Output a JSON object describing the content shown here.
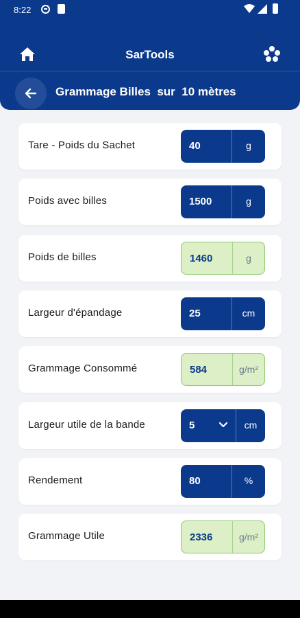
{
  "status_bar": {
    "time": "8:22"
  },
  "header": {
    "app_title": "SarTools",
    "screen_title": "Grammage Billes  sur  10 mètres",
    "icons": {
      "home": "home-icon",
      "settings": "flower-settings-icon",
      "back": "arrow-left-icon"
    }
  },
  "colors": {
    "primary": "#0b3a8c",
    "computed_bg": "#dcefc6",
    "computed_border": "#8cc96f",
    "page_bg": "#f1f3f7"
  },
  "rows": [
    {
      "label": "Tare - Poids du Sachet",
      "value": "40",
      "unit": "g",
      "kind": "input"
    },
    {
      "label": "Poids avec billes",
      "value": "1500",
      "unit": "g",
      "kind": "input"
    },
    {
      "label": "Poids de billes",
      "value": "1460",
      "unit": "g",
      "kind": "computed"
    },
    {
      "label": "Largeur d'épandage",
      "value": "25",
      "unit": "cm",
      "kind": "input"
    },
    {
      "label": "Grammage Consommé",
      "value": "584",
      "unit": "g/m²",
      "kind": "computed"
    },
    {
      "label": "Largeur utile de la bande",
      "value": "5",
      "unit": "cm",
      "kind": "select"
    },
    {
      "label": "Rendement",
      "value": "80",
      "unit": "%",
      "kind": "input"
    },
    {
      "label": "Grammage Utile",
      "value": "2336",
      "unit": "g/m²",
      "kind": "computed"
    }
  ]
}
